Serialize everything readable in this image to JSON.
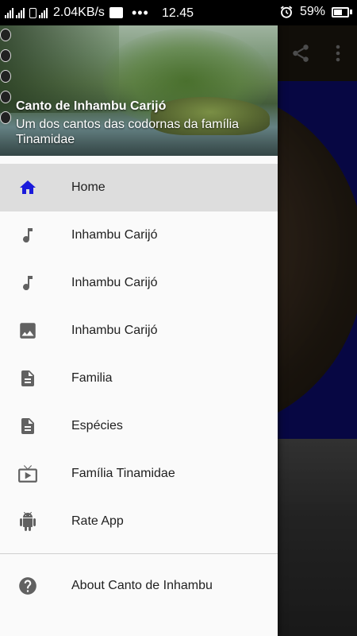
{
  "status_bar": {
    "speed": "2.04KB/s",
    "dots": "•••",
    "time": "12.45",
    "battery": "59%"
  },
  "drawer": {
    "header": {
      "title": "Canto de Inhambu Carijó",
      "subtitle": "Um dos cantos das codornas da família Tinamidae"
    },
    "items": [
      {
        "label": "Home",
        "icon": "home-icon",
        "selected": true
      },
      {
        "label": "Inhambu Carijó",
        "icon": "music-note-icon"
      },
      {
        "label": "Inhambu Carijó",
        "icon": "music-note-icon"
      },
      {
        "label": "Inhambu Carijó",
        "icon": "image-icon"
      },
      {
        "label": "Familia",
        "icon": "document-icon"
      },
      {
        "label": "Espécies",
        "icon": "document-icon"
      },
      {
        "label": "Família Tinamidae",
        "icon": "tv-play-icon"
      },
      {
        "label": "Rate App",
        "icon": "android-icon"
      }
    ],
    "footer_items": [
      {
        "label": "About Canto de Inhambu",
        "icon": "help-icon"
      }
    ]
  },
  "colors": {
    "accent": "#1a1adb",
    "icon_grey": "#616161",
    "selected_bg": "#dddddd",
    "content_bg": "#0d0d7a"
  }
}
